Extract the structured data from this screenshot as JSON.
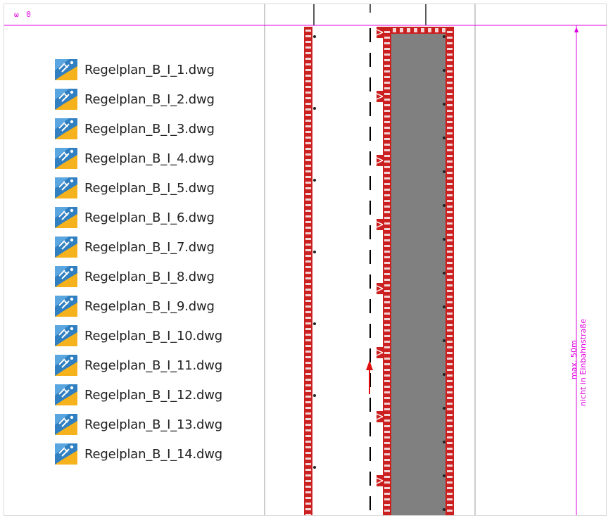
{
  "explorer": {
    "files": [
      {
        "name": "Regelplan_B_I_1.dwg",
        "icon": "autocad-dwg-file-icon"
      },
      {
        "name": "Regelplan_B_I_2.dwg",
        "icon": "autocad-dwg-file-icon"
      },
      {
        "name": "Regelplan_B_I_3.dwg",
        "icon": "autocad-dwg-file-icon"
      },
      {
        "name": "Regelplan_B_I_4.dwg",
        "icon": "autocad-dwg-file-icon"
      },
      {
        "name": "Regelplan_B_I_5.dwg",
        "icon": "autocad-dwg-file-icon"
      },
      {
        "name": "Regelplan_B_I_6.dwg",
        "icon": "autocad-dwg-file-icon"
      },
      {
        "name": "Regelplan_B_I_7.dwg",
        "icon": "autocad-dwg-file-icon"
      },
      {
        "name": "Regelplan_B_I_8.dwg",
        "icon": "autocad-dwg-file-icon"
      },
      {
        "name": "Regelplan_B_I_9.dwg",
        "icon": "autocad-dwg-file-icon"
      },
      {
        "name": "Regelplan_B_I_10.dwg",
        "icon": "autocad-dwg-file-icon"
      },
      {
        "name": "Regelplan_B_I_11.dwg",
        "icon": "autocad-dwg-file-icon"
      },
      {
        "name": "Regelplan_B_I_12.dwg",
        "icon": "autocad-dwg-file-icon"
      },
      {
        "name": "Regelplan_B_I_13.dwg",
        "icon": "autocad-dwg-file-icon"
      },
      {
        "name": "Regelplan_B_I_14.dwg",
        "icon": "autocad-dwg-file-icon"
      }
    ]
  },
  "drawing": {
    "top_label": "ω 0",
    "dimension_text": [
      "max. 50m",
      "nicht in Einbahnstraße"
    ],
    "colors": {
      "dimension": "#e100e1",
      "barrier": "#cc1f1f",
      "closed_area": "#808080",
      "road_line": "#000000",
      "arrow": "#e01010"
    }
  }
}
